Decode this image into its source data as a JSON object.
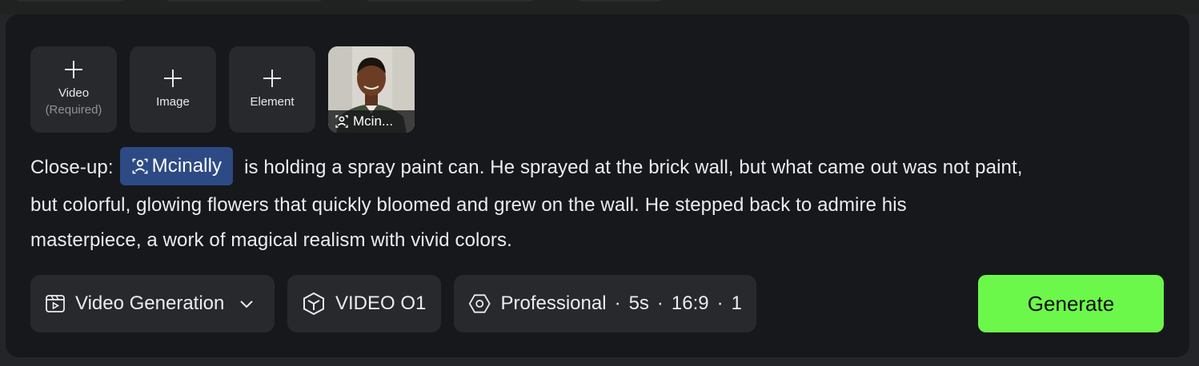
{
  "colors": {
    "panel_bg": "#16181b",
    "tile_bg": "#27292d",
    "chip_bg": "#2d4a85",
    "generate_bg": "#6cf84a"
  },
  "reference_tiles": [
    {
      "label": "Video",
      "sub": "(Required)",
      "icon": "plus-icon"
    },
    {
      "label": "Image",
      "sub": "",
      "icon": "plus-icon"
    },
    {
      "label": "Element",
      "sub": "",
      "icon": "plus-icon"
    }
  ],
  "element_card": {
    "caption": "Mcin...",
    "icon": "character-icon"
  },
  "prompt": {
    "prefix": "Close-up:",
    "mention": "Mcinally",
    "mention_icon": "character-icon",
    "line1_rest": "is holding a spray paint can. He sprayed at the brick wall, but what came out was not paint,",
    "line2": "but colorful, glowing flowers that quickly bloomed and grew on the wall. He stepped back to admire his",
    "line3": "masterpiece, a work of magical realism with vivid colors."
  },
  "controls": {
    "mode": {
      "label": "Video Generation",
      "icon": "video-clip-icon",
      "dropdown_icon": "chevron-down-icon"
    },
    "model": {
      "label": "VIDEO O1",
      "icon": "cube-icon"
    },
    "settings": {
      "icon": "hexagon-settings-icon",
      "quality": "Professional",
      "duration": "5s",
      "aspect": "16:9",
      "count": "1",
      "separator": "·"
    }
  },
  "generate": {
    "label": "Generate"
  }
}
